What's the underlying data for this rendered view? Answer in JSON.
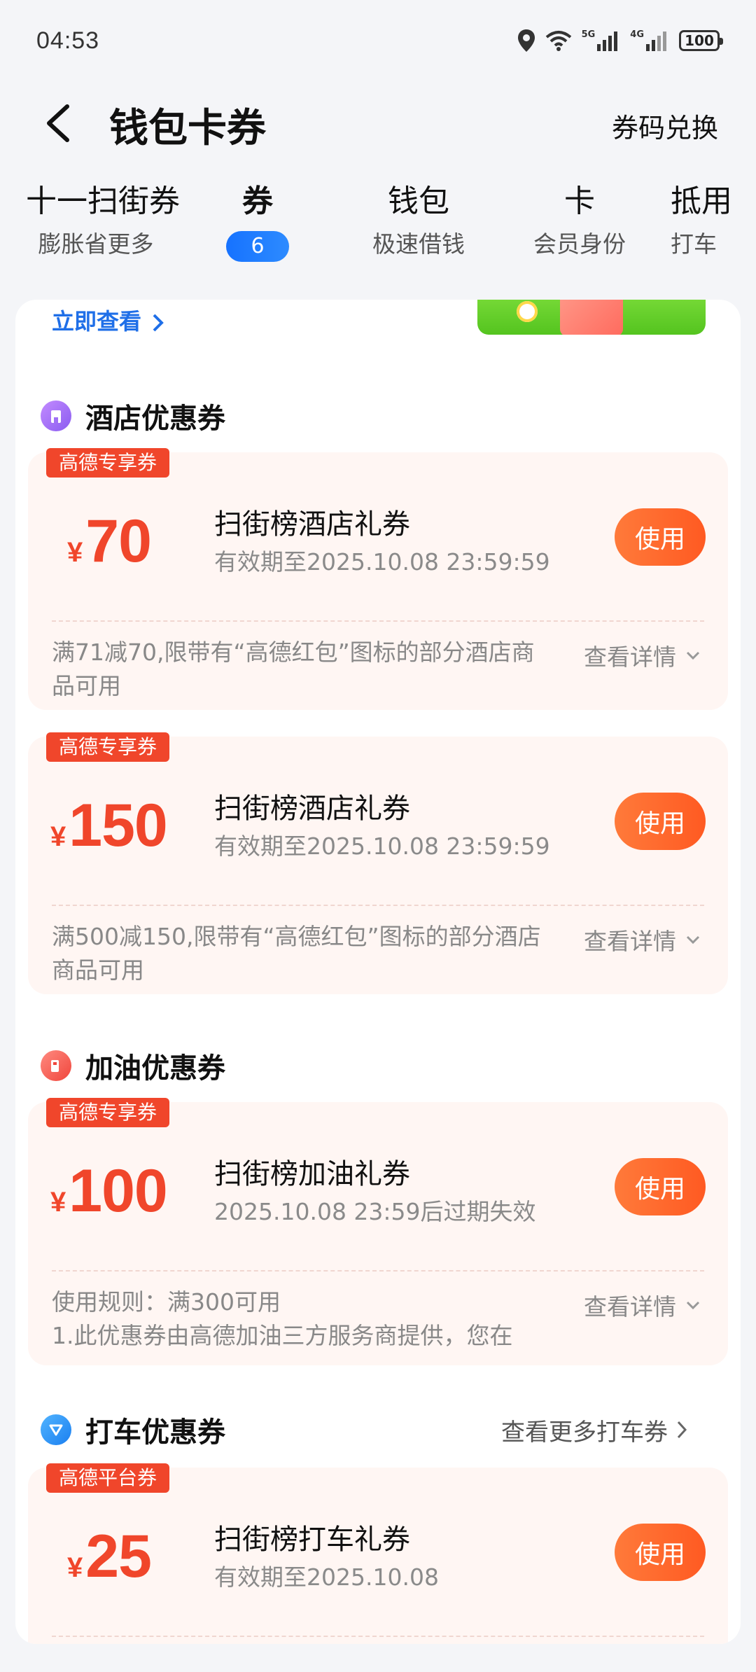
{
  "status_bar": {
    "time": "04:53",
    "net_5g": "5G",
    "net_4g": "4G",
    "battery": "100"
  },
  "header": {
    "title": "钱包卡券",
    "redeem": "券码兑换"
  },
  "tabs": [
    {
      "title": "十一扫街券",
      "sub": "膨胀省更多"
    },
    {
      "title": "券",
      "badge": "6"
    },
    {
      "title": "钱包",
      "sub": "极速借钱"
    },
    {
      "title": "卡",
      "sub": "会员身份"
    },
    {
      "title": "抵用",
      "sub": "打车"
    }
  ],
  "banner": {
    "link": "立即查看"
  },
  "sections": {
    "hotel": {
      "title": "酒店优惠券"
    },
    "fuel": {
      "title": "加油优惠券"
    },
    "taxi": {
      "title": "打车优惠券",
      "more": "查看更多打车券"
    }
  },
  "coupons": [
    {
      "tag": "高德专享券",
      "symbol": "¥",
      "amount": "70",
      "name": "扫街榜酒店礼券",
      "expiry": "有效期至2025.10.08 23:59:59",
      "use": "使用",
      "desc": "满71减70,限带有“高德红包”图标的部分酒店商品可用",
      "detail": "查看详情"
    },
    {
      "tag": "高德专享券",
      "symbol": "¥",
      "amount": "150",
      "name": "扫街榜酒店礼券",
      "expiry": "有效期至2025.10.08 23:59:59",
      "use": "使用",
      "desc": "满500减150,限带有“高德红包”图标的部分酒店商品可用",
      "detail": "查看详情"
    },
    {
      "tag": "高德专享券",
      "symbol": "¥",
      "amount": "100",
      "name": "扫街榜加油礼券",
      "expiry": "2025.10.08 23:59后过期失效",
      "use": "使用",
      "desc_line1": "使用规则：满300可用",
      "desc_line2": "1.此优惠券由高德加油三方服务商提供，您在",
      "detail": "查看详情"
    },
    {
      "tag": "高德平台券",
      "symbol": "¥",
      "amount": "25",
      "name": "扫街榜打车礼券",
      "expiry": "有效期至2025.10.08",
      "use": "使用"
    }
  ],
  "colors": {
    "accent_red": "#f0462b",
    "use_button": "#ff6a2c",
    "badge_blue": "#1672ff",
    "link_blue": "#1f6fe8"
  },
  "icons": [
    "location-icon",
    "wifi-icon",
    "signal-icon",
    "battery-icon",
    "back-arrow-icon",
    "hotel-icon",
    "fuel-icon",
    "taxi-icon",
    "chevron-right-icon",
    "chevron-down-icon"
  ]
}
